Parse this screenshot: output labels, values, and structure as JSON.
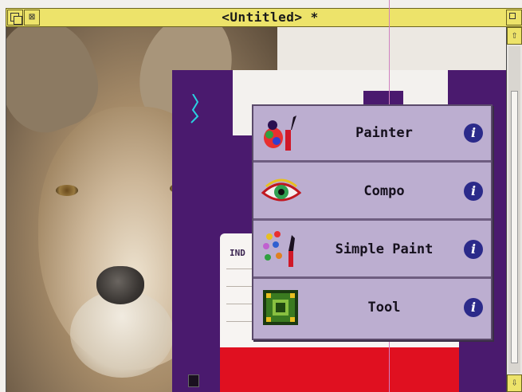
{
  "window": {
    "title": "<Untitled> *"
  },
  "iconbar_menu": {
    "items": [
      {
        "label": "Painter",
        "icon": "painter-app-icon",
        "info": "i"
      },
      {
        "label": "Compo",
        "icon": "compo-eye-icon",
        "info": "i"
      },
      {
        "label": "Simple Paint",
        "icon": "simple-paint-icon",
        "info": "i"
      },
      {
        "label": "Tool",
        "icon": "tool-grid-icon",
        "info": "i"
      }
    ]
  },
  "colors": {
    "titlebar": "#ede36a",
    "menu_bg": "#bcaed0",
    "info_button": "#2b2a8a",
    "disk": "#4a1a6e"
  },
  "canvas": {
    "disk_label_text": "IND"
  }
}
